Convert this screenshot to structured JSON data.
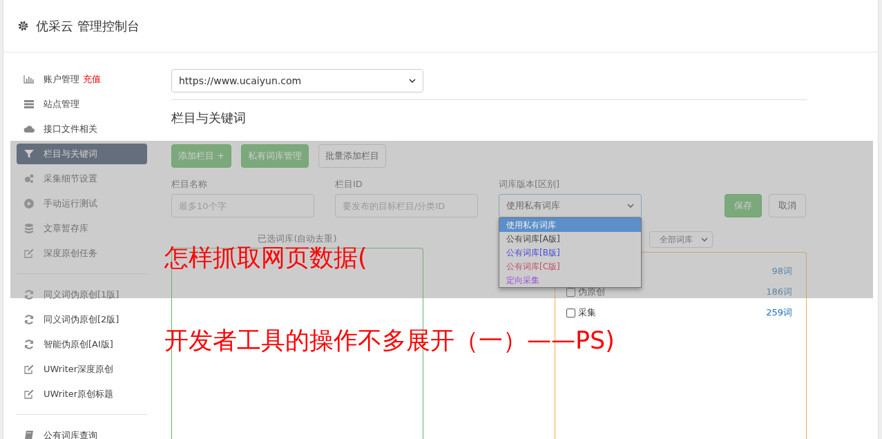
{
  "header": {
    "title": "优采云 管理控制台"
  },
  "sidebar": {
    "groups": [
      [
        {
          "label": "账户管理",
          "badge": "充值",
          "selected": false
        },
        {
          "label": "站点管理",
          "selected": false
        },
        {
          "label": "接口文件相关",
          "selected": false
        },
        {
          "label": "栏目与关键词",
          "selected": true
        },
        {
          "label": "采集细节设置",
          "selected": false
        },
        {
          "label": "手动运行测试",
          "selected": false
        },
        {
          "label": "文章暂存库",
          "selected": false
        },
        {
          "label": "深度原创任务",
          "selected": false
        }
      ],
      [
        {
          "label": "同义词伪原创[1版]",
          "selected": false
        },
        {
          "label": "同义词伪原创[2版]",
          "selected": false
        },
        {
          "label": "智能伪原创[AI版]",
          "selected": false
        },
        {
          "label": "UWriter深度原创",
          "selected": false
        },
        {
          "label": "UWriter原创标题",
          "selected": false
        }
      ],
      [
        {
          "label": "公有词库查询",
          "selected": false
        }
      ]
    ]
  },
  "site_select": {
    "value": "https://www.ucaiyun.com"
  },
  "section_title": "栏目与关键词",
  "toolbar": [
    {
      "label": "添加栏目 +",
      "kind": "primary"
    },
    {
      "label": "私有词库管理",
      "kind": "primary"
    },
    {
      "label": "批量添加栏目",
      "kind": "default"
    }
  ],
  "form": {
    "name": {
      "label": "栏目名称",
      "placeholder": "最多10个字"
    },
    "id": {
      "label": "栏目ID",
      "placeholder": "要发布的目标栏目/分类ID"
    },
    "version": {
      "label": "词库版本[区别]",
      "value": "使用私有词库",
      "options": [
        {
          "label": "使用私有词库",
          "selected": true
        },
        {
          "label": "公有词库[A版]",
          "selected": false
        },
        {
          "label": "公有词库[B版]",
          "selected": false,
          "color": "#4a48dc"
        },
        {
          "label": "公有词库[C版]",
          "selected": false,
          "color": "#c0506a"
        },
        {
          "label": "定向采集",
          "selected": false,
          "color": "#9b4fdc"
        }
      ]
    },
    "save": "保存",
    "cancel": "取消"
  },
  "selected_label": "已选词库(自动去重)",
  "filter_select": {
    "value": "全部词库"
  },
  "library_rows": [
    {
      "count": "98词"
    },
    {
      "name": "伪原创",
      "count": "186词",
      "checked": false
    },
    {
      "name": "采集",
      "count": "259词",
      "checked": false
    }
  ],
  "caption": [
    "怎样抓取网页数据(",
    "开发者工具的操作不多展开（一）——PS)"
  ]
}
